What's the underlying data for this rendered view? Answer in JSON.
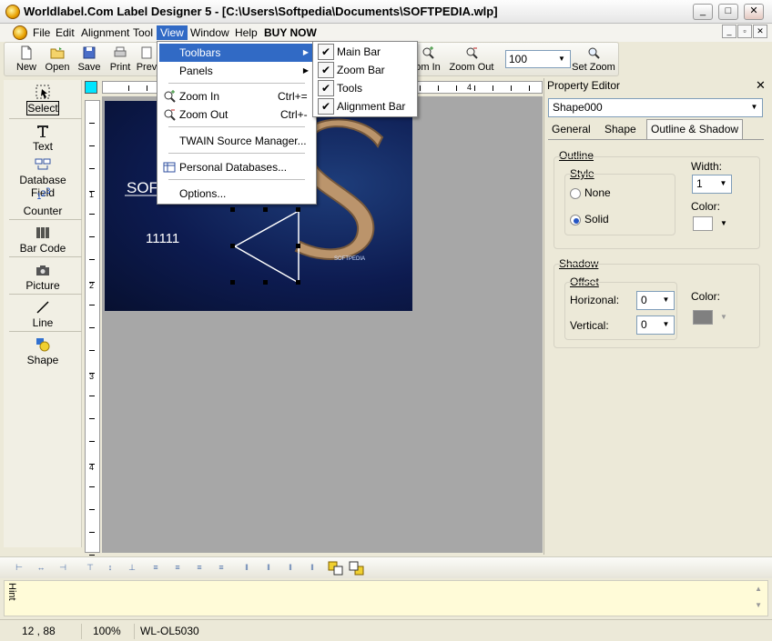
{
  "window": {
    "title": "Worldlabel.Com Label Designer 5  - [C:\\Users\\Softpedia\\Documents\\SOFTPEDIA.wlp]",
    "controls": [
      "_",
      "□",
      "✕"
    ]
  },
  "menubar": {
    "items": [
      "File",
      "Edit",
      "Alignment",
      "Tool",
      "View",
      "Window",
      "Help",
      "BUY NOW"
    ],
    "active": "View"
  },
  "toolbar": {
    "buttons": [
      "New",
      "Open",
      "Save",
      "Print",
      "Prev",
      "om In",
      "Zoom Out",
      "Set Zoom"
    ],
    "zoom_value": "100"
  },
  "view_menu": {
    "items": [
      "Toolbars",
      "Panels",
      "Zoom In",
      "Zoom Out",
      "TWAIN Source Manager...",
      "Personal Databases...",
      "Options..."
    ],
    "shortcuts": {
      "zoom_in": "Ctrl+=",
      "zoom_out": "Ctrl+-"
    }
  },
  "toolbars_submenu": {
    "items": [
      "Main Bar",
      "Zoom Bar",
      "Tools",
      "Alignment Bar"
    ],
    "checked": [
      true,
      true,
      true,
      true
    ]
  },
  "tools": [
    "Select",
    "Text",
    "Database Field",
    "Counter",
    "Bar Code",
    "Picture",
    "Line",
    "Shape"
  ],
  "ruler": {
    "h_numbers": [
      "4"
    ],
    "v_numbers": [
      "1",
      "2",
      "3",
      "4"
    ]
  },
  "label": {
    "text_softpedia": "SOF",
    "counter_value": "11111",
    "logo_text": "SOFTPEDIA"
  },
  "property_editor": {
    "title": "Property Editor",
    "object": "Shape000",
    "tabs": [
      "General",
      "Shape",
      "Outline & Shadow"
    ],
    "active_tab": "Outline & Shadow",
    "outline": {
      "group": "Outline",
      "style_label": "Style",
      "style_options": [
        "None",
        "Solid"
      ],
      "style_selected": "Solid",
      "width_label": "Width:",
      "width_value": "1",
      "color_label": "Color:",
      "color": "#ffffff"
    },
    "shadow": {
      "group": "Shadow",
      "offset_label": "Offset",
      "horizontal_label": "Horizonal:",
      "horizontal_value": "0",
      "vertical_label": "Vertical:",
      "vertical_value": "0",
      "color_label": "Color:",
      "color": "#808080"
    }
  },
  "hint": {
    "label": "Hint"
  },
  "status": {
    "coords": "12 , 88",
    "zoom": "100%",
    "label_type": "WL-OL5030"
  },
  "colors": {
    "highlight": "#316ac5",
    "label_bg": "#0d1b50",
    "canvas_bg": "#a7a7a7"
  }
}
